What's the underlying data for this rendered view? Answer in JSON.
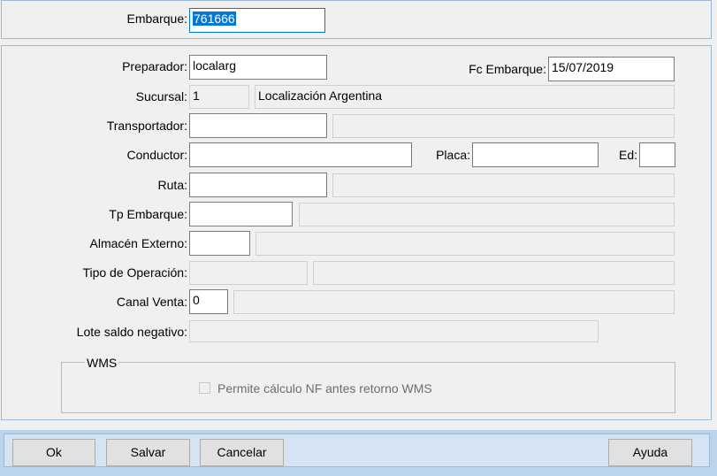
{
  "embarque": {
    "label": "Embarque:",
    "value": "761666"
  },
  "form": {
    "preparador": {
      "label": "Preparador:",
      "value": "localarg"
    },
    "fc_embarque": {
      "label": "Fc Embarque:",
      "value": "15/07/2019"
    },
    "sucursal": {
      "label": "Sucursal:",
      "code": "1",
      "name": "Localización Argentina"
    },
    "transportador": {
      "label": "Transportador:",
      "value": "",
      "description": ""
    },
    "conductor": {
      "label": "Conductor:",
      "value": ""
    },
    "placa": {
      "label": "Placa:",
      "value": ""
    },
    "ed": {
      "label": "Ed:",
      "value": ""
    },
    "ruta": {
      "label": "Ruta:",
      "value": "",
      "description": ""
    },
    "tp_embarque": {
      "label": "Tp Embarque:",
      "value": "",
      "description": ""
    },
    "almacen_externo": {
      "label": "Almacén Externo:",
      "value": "",
      "description": ""
    },
    "tipo_operacion": {
      "label": "Tipo de Operación:",
      "value": "",
      "description": ""
    },
    "canal_venta": {
      "label": "Canal Venta:",
      "value": "0",
      "description": ""
    },
    "lote_saldo_negativo": {
      "label": "Lote saldo negativo:",
      "value": ""
    }
  },
  "wms": {
    "title": "WMS",
    "checkbox_label": "Permite cálculo NF antes retorno WMS",
    "checked": false
  },
  "buttons": {
    "ok": "Ok",
    "salvar": "Salvar",
    "cancelar": "Cancelar",
    "ayuda": "Ayuda"
  }
}
